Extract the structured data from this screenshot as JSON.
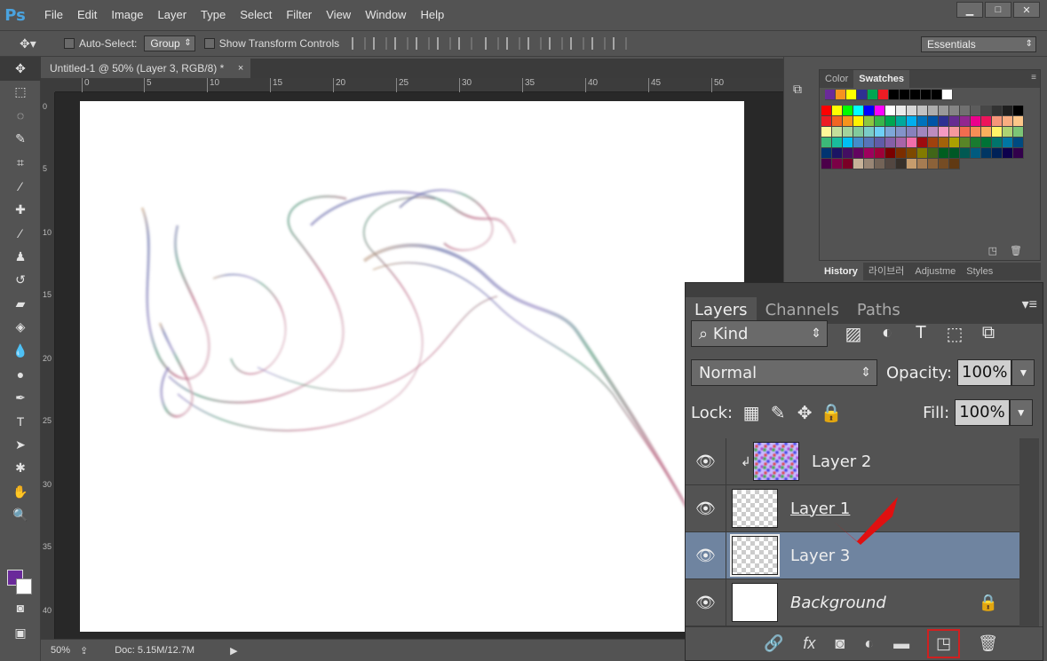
{
  "app": {
    "logo": "Ps"
  },
  "menu": [
    "File",
    "Edit",
    "Image",
    "Layer",
    "Type",
    "Select",
    "Filter",
    "View",
    "Window",
    "Help"
  ],
  "window_controls": [
    "▁",
    "□",
    "✕"
  ],
  "options": {
    "auto_select_label": "Auto-Select:",
    "auto_select_value": "Group",
    "transform_label": "Show Transform Controls",
    "workspace": "Essentials"
  },
  "document": {
    "tab_title": "Untitled-1 @ 50% (Layer 3, RGB/8) *",
    "close": "×",
    "ruler_top": [
      "0",
      "5",
      "10",
      "15",
      "20",
      "25",
      "30",
      "35",
      "40",
      "45",
      "50"
    ],
    "ruler_left": [
      "0",
      "5",
      "10",
      "15",
      "20",
      "25",
      "30",
      "35",
      "40"
    ],
    "zoom": "50%",
    "doc_size": "Doc: 5.15M/12.7M"
  },
  "swatches_panel": {
    "tabs": [
      "Color",
      "Swatches"
    ],
    "recent": [
      "#6a2a9a",
      "#f7931e",
      "#ffff00",
      "#2e3192",
      "#00a651",
      "#ed1c24",
      "#000000",
      "#000000",
      "#000000",
      "#000000",
      "#000000",
      "#ffffff"
    ],
    "colors": [
      "#ff0000",
      "#ffff00",
      "#00ff00",
      "#00ffff",
      "#0000ff",
      "#ff00ff",
      "#ffffff",
      "#ebebeb",
      "#d7d7d7",
      "#c2c2c2",
      "#adadad",
      "#999999",
      "#858585",
      "#707070",
      "#5c5c5c",
      "#474747",
      "#333333",
      "#1f1f1f",
      "#000000",
      "#ed1c24",
      "#f26522",
      "#f7941d",
      "#fff200",
      "#8dc63f",
      "#39b54a",
      "#00a651",
      "#00a99d",
      "#00aeef",
      "#0072bc",
      "#0054a6",
      "#2e3192",
      "#662d91",
      "#92278f",
      "#ec008c",
      "#ed145b",
      "#f69679",
      "#f9ad81",
      "#fdc689",
      "#fff799",
      "#c4df9b",
      "#a3d39c",
      "#82ca9c",
      "#7accc8",
      "#6dcff6",
      "#7da7d9",
      "#8393ca",
      "#8781bd",
      "#a187be",
      "#bd8cbf",
      "#f49ac1",
      "#f5989d",
      "#f26c4f",
      "#f68e56",
      "#fbaf5d",
      "#fff568",
      "#acd373",
      "#7cc576",
      "#3cb878",
      "#1abc9c",
      "#00bff3",
      "#448ccb",
      "#5674b9",
      "#605ca8",
      "#855fa8",
      "#a864a8",
      "#f06eaa",
      "#9e0b0f",
      "#a0410d",
      "#a3620a",
      "#aba000",
      "#598527",
      "#197b30",
      "#007236",
      "#00746b",
      "#0076a3",
      "#004a80",
      "#003471",
      "#1b1464",
      "#440e62",
      "#630460",
      "#9e005d",
      "#9e0039",
      "#790000",
      "#7b2e00",
      "#7d4900",
      "#827b00",
      "#406618",
      "#005e20",
      "#005826",
      "#005952",
      "#005b7f",
      "#003663",
      "#002157",
      "#0d004c",
      "#32004b",
      "#4b0049",
      "#7b0046",
      "#7a0026",
      "#c7b299",
      "#998675",
      "#736357",
      "#534741",
      "#37302a",
      "#c69c6d",
      "#a67c52",
      "#8c6239",
      "#754c24",
      "#603913"
    ]
  },
  "history_tabs": [
    "History",
    "라이브러",
    "Adjustme",
    "Styles"
  ],
  "layers_panel": {
    "tabs": [
      "Layers",
      "Channels",
      "Paths"
    ],
    "filter_kind": "Kind",
    "blend_mode": "Normal",
    "opacity_label": "Opacity:",
    "opacity_value": "100%",
    "lock_label": "Lock:",
    "fill_label": "Fill:",
    "fill_value": "100%",
    "layers": [
      {
        "name": "Layer 2"
      },
      {
        "name": "Layer 1"
      },
      {
        "name": "Layer 3"
      },
      {
        "name": "Background"
      }
    ]
  }
}
